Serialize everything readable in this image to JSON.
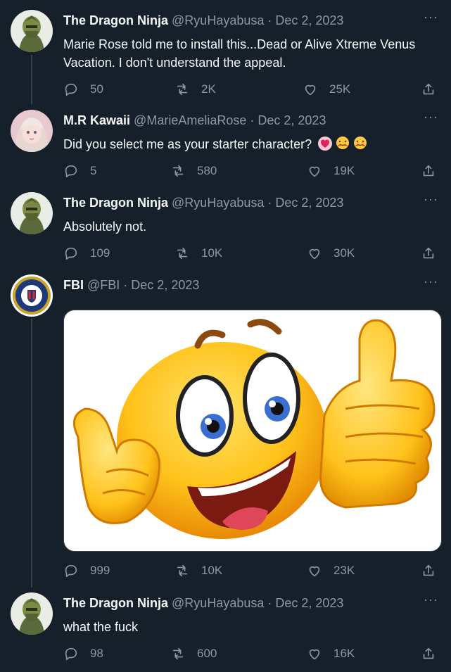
{
  "tweets": [
    {
      "author_name": "The Dragon Ninja",
      "handle": "@RyuHayabusa",
      "date": "Dec 2, 2023",
      "text": "Marie Rose told me to install this...Dead or Alive Xtreme Venus Vacation. I don't understand the appeal.",
      "replies": "50",
      "retweets": "2K",
      "likes": "25K"
    },
    {
      "author_name": "M.R Kawaii",
      "handle": "@MarieAmeliaRose",
      "date": "Dec 2, 2023",
      "text": "Did you select me as your starter character?",
      "emoji": [
        "heart-emoji",
        "hugging-face-emoji",
        "hugging-face-emoji"
      ],
      "replies": "5",
      "retweets": "580",
      "likes": "19K"
    },
    {
      "author_name": "The Dragon Ninja",
      "handle": "@RyuHayabusa",
      "date": "Dec 2, 2023",
      "text": "Absolutely not.",
      "replies": "109",
      "retweets": "10K",
      "likes": "30K"
    },
    {
      "author_name": "FBI",
      "handle": "@FBI",
      "date": "Dec 2, 2023",
      "text": "",
      "media": "thumbs-up-emoji-face-image",
      "replies": "999",
      "retweets": "10K",
      "likes": "23K"
    },
    {
      "author_name": "The Dragon Ninja",
      "handle": "@RyuHayabusa",
      "date": "Dec 2, 2023",
      "text": "what the fuck",
      "replies": "98",
      "retweets": "600",
      "likes": "16K"
    }
  ],
  "separator": " · ",
  "more_label": "···",
  "colors": {
    "background": "#15202b",
    "text": "#f7f9f9",
    "muted": "#8b98a5",
    "thread_line": "#38444d"
  }
}
